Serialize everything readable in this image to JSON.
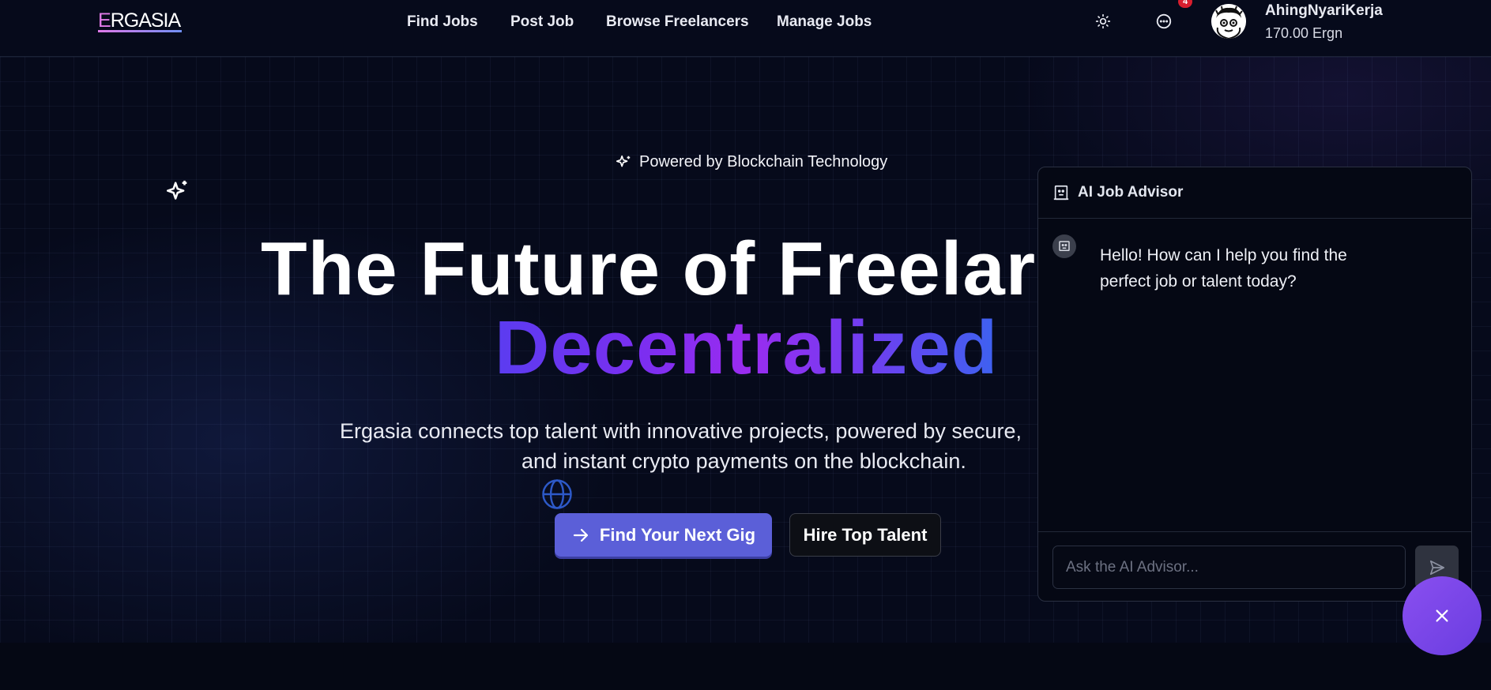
{
  "header": {
    "logo_first": "E",
    "logo_rest": "RGASIA",
    "nav": [
      "Find Jobs",
      "Post Job",
      "Browse Freelancers",
      "Manage Jobs"
    ],
    "notification_count": "4",
    "username": "AhingNyariKerja",
    "balance": "170.00 Ergn"
  },
  "hero": {
    "powered_by": "Powered by Blockchain Technology",
    "title": "The Future of Freelar",
    "title_highlight": "Decentralized",
    "description_line1": "Ergasia connects top talent with innovative projects, powered by secure,",
    "description_line2": "and instant crypto payments on the blockchain.",
    "primary_button": "Find Your Next Gig",
    "secondary_button": "Hire Top Talent"
  },
  "chat": {
    "title": "AI Job Advisor",
    "bot_message": "Hello! How can I help you find the perfect job or talent today?",
    "input_placeholder": "Ask the AI Advisor..."
  },
  "colors": {
    "accent": "#5b5fd8",
    "gradient_start": "#5b3cf0",
    "gradient_mid": "#9a2cf0",
    "gradient_end": "#3d62f0",
    "fab": "#8a4ff0",
    "badge": "#d81e2e"
  },
  "icons": {
    "theme_toggle": "sun-icon",
    "messages": "chat-bubble-icon",
    "powered": "sparkle-icon",
    "chat_header": "bot-icon",
    "send": "send-icon",
    "close": "close-icon",
    "primary_button": "arrow-right-icon"
  }
}
